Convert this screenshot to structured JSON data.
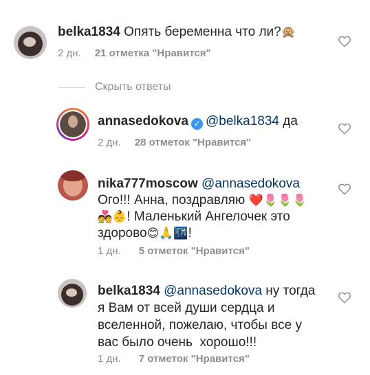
{
  "comments": [
    {
      "username": "belka1834",
      "text": "Опять беременна что ли?",
      "emoji": "🙊",
      "time": "2 дн.",
      "likes": "21 отметка \"Нравится\""
    },
    {
      "username": "annasedokova",
      "mention": "@belka1834",
      "text": " да",
      "time": "2 дн.",
      "likes": "28 отметок \"Нравится\""
    },
    {
      "username": "nika777moscow",
      "mention": "@annasedokova",
      "line1": "Ого!!! Анна, поздравляю ",
      "line1_emoji": "❤️🌷🌷🌷",
      "line2_emoji": "💑👶",
      "line2": "! Маленький Ангелочек это",
      "line3": "здорово",
      "line3_emoji": "😊🙏🌃",
      "line3_end": "!",
      "time": "1 дн.",
      "likes": "5 отметок \"Нравится\""
    },
    {
      "username": "belka1834",
      "mention": "@annasedokova",
      "line1": " ну тогда",
      "line2": "я Вам от всей души сердца и",
      "line3": "вселенной, пожелаю, чтобы все у",
      "line4": "вас было очень  хорошо!!!",
      "time": "1 дн.",
      "likes": "7 отметок \"Нравится\""
    }
  ],
  "hide_replies": "Скрыть ответы",
  "verified_badge": "✓",
  "icons": {
    "heart": "heart-outline-icon",
    "verified": "verified-badge-icon"
  },
  "colors": {
    "text": "#262626",
    "meta": "#8e8e8e",
    "mention": "#00376b",
    "verified": "#3897f0"
  }
}
